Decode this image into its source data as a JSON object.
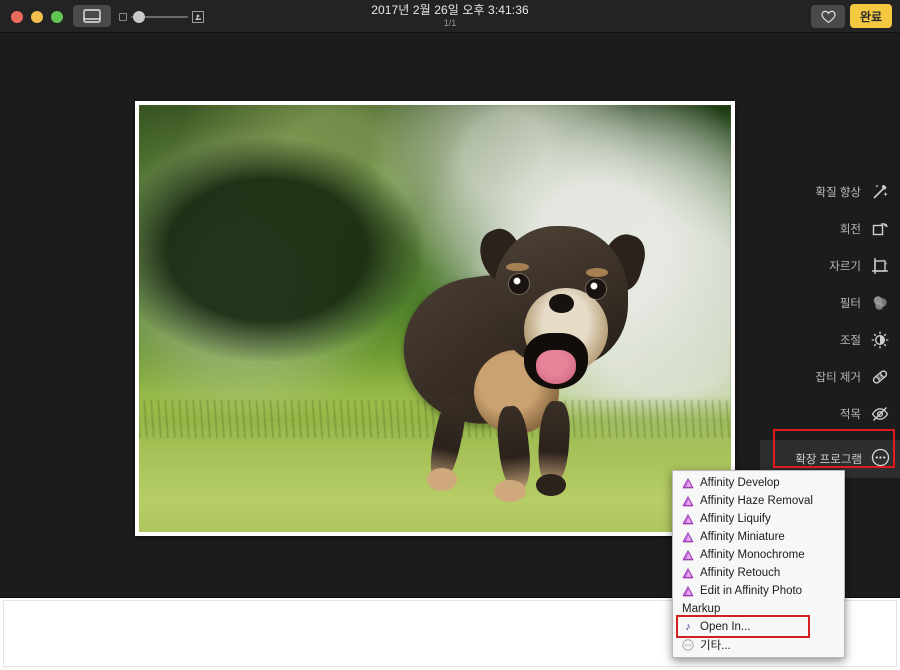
{
  "window": {
    "title": "2017년 2월 26일 오후 3:41:36",
    "subtitle": "1/1"
  },
  "toolbar": {
    "sidebar_toggle_icon": "sidebar-toggle-icon",
    "zoom_small_icon": "zoom-out-thumbnail-icon",
    "zoom_large_icon": "zoom-in-thumbnail-icon",
    "favorite_icon": "heart-icon",
    "done_label": "완료"
  },
  "tools": [
    {
      "label": "확질 향상",
      "icon": "magic-wand-icon"
    },
    {
      "label": "회전",
      "icon": "rotate-icon"
    },
    {
      "label": "자르기",
      "icon": "crop-icon"
    },
    {
      "label": "필터",
      "icon": "filters-icon"
    },
    {
      "label": "조절",
      "icon": "adjust-dial-icon"
    },
    {
      "label": "잡티 제거",
      "icon": "retouch-bandage-icon"
    },
    {
      "label": "적목",
      "icon": "red-eye-icon"
    }
  ],
  "extensions_button": {
    "label": "확장 프로그램",
    "icon": "ellipsis-circle-icon",
    "highlighted": true
  },
  "extensions_menu": {
    "items": [
      {
        "label": "Affinity Develop",
        "icon": "affinity-icon"
      },
      {
        "label": "Affinity Haze Removal",
        "icon": "affinity-icon"
      },
      {
        "label": "Affinity Liquify",
        "icon": "affinity-icon"
      },
      {
        "label": "Affinity Miniature",
        "icon": "affinity-icon"
      },
      {
        "label": "Affinity Monochrome",
        "icon": "affinity-icon"
      },
      {
        "label": "Affinity Retouch",
        "icon": "affinity-icon"
      },
      {
        "label": "Edit in Affinity Photo",
        "icon": "affinity-icon"
      },
      {
        "label": "Markup",
        "icon": "none"
      },
      {
        "label": "Open In...",
        "icon": "open-in-icon",
        "highlighted": true
      },
      {
        "label": "기타...",
        "icon": "ellipsis-circle-icon"
      }
    ]
  },
  "photo": {
    "alt": "running puppy on grass"
  },
  "colors": {
    "accent_done": "#f5c842",
    "highlight": "#e01b1b",
    "titlebar": "#232323",
    "canvas": "#1c1c1c",
    "menu_bg": "#f7f7f7"
  }
}
